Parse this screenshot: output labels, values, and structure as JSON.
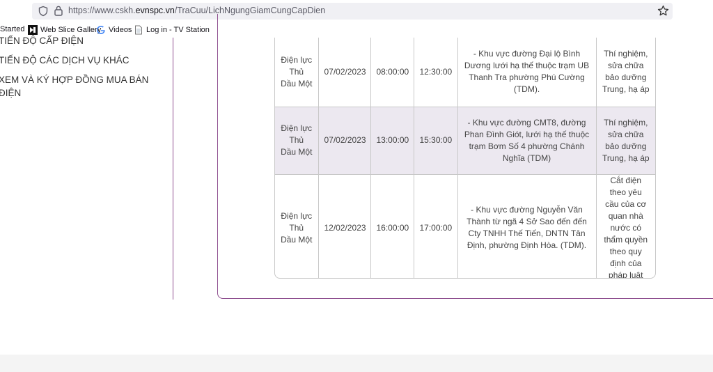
{
  "browser": {
    "url_prefix": "https://www.cskh.",
    "url_host": "evnspc.vn",
    "url_path": "/TraCuu/LichNgungGiamCungCapDien"
  },
  "bookmarks": [
    {
      "label": "Started",
      "icon": "none"
    },
    {
      "label": "Web Slice Gallery",
      "icon": "web-slice-icon"
    },
    {
      "label": "Videos",
      "icon": "google-icon"
    },
    {
      "label": "Log in - TV Station",
      "icon": "page-icon"
    }
  ],
  "sidebar": {
    "items": [
      "TIẾN ĐỘ CẤP ĐIỆN",
      "TIẾN ĐỘ CÁC DỊCH VỤ KHÁC",
      "XEM VÀ KÝ HỢP ĐỒNG MUA BÁN",
      "ĐIỆN"
    ]
  },
  "table": {
    "rows": [
      {
        "unit": "Điện lực Thủ Dầu Một",
        "date": "07/02/2023",
        "start": "08:00:00",
        "end": "12:30:00",
        "area": "- Khu vực đường Đại lộ Bình Dương lưới hạ thế thuộc trạm UB Thanh Tra phường Phú Cường (TDM).",
        "reason": "Thí nghiệm, sửa chữa bảo dưỡng Trung, hạ áp"
      },
      {
        "unit": "Điện lực Thủ Dầu Một",
        "date": "07/02/2023",
        "start": "13:00:00",
        "end": "15:30:00",
        "area": "- Khu vực đường CMT8, đường Phan Đình Giót, lưới hạ thế thuộc trạm Bơm Số 4 phường Chánh Nghĩa (TDM)",
        "reason": "Thí nghiệm, sửa chữa bảo dưỡng Trung, hạ áp"
      },
      {
        "unit": "Điện lực Thủ Dầu Một",
        "date": "12/02/2023",
        "start": "16:00:00",
        "end": "17:00:00",
        "area": "- Khu vực đường Nguyễn Văn Thành từ ngã 4 Sở Sao đến đến Cty TNHH Thế Tiến, DNTN Tân Định, phường Định Hòa. (TDM).",
        "reason": "Cắt điện theo yêu cầu của cơ quan nhà nước có thẩm quyền theo quy định của pháp luật"
      }
    ]
  }
}
